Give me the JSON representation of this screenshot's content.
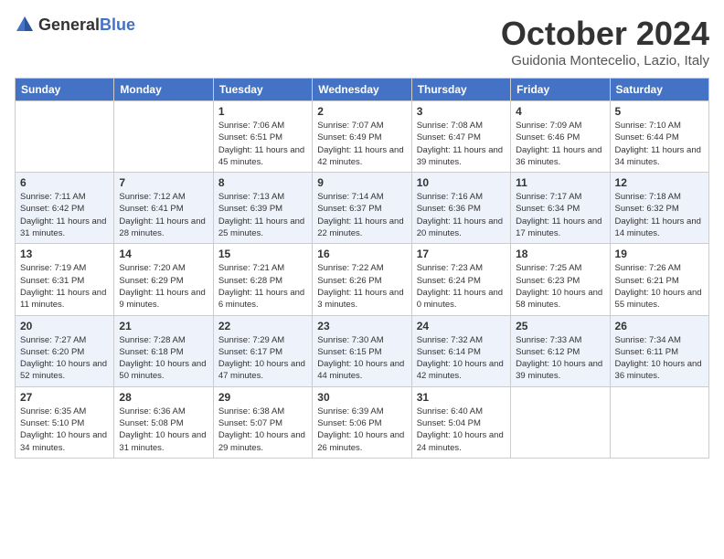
{
  "header": {
    "logo_general": "General",
    "logo_blue": "Blue",
    "month_title": "October 2024",
    "location": "Guidonia Montecelio, Lazio, Italy"
  },
  "days_of_week": [
    "Sunday",
    "Monday",
    "Tuesday",
    "Wednesday",
    "Thursday",
    "Friday",
    "Saturday"
  ],
  "weeks": [
    [
      {
        "day": "",
        "content": ""
      },
      {
        "day": "",
        "content": ""
      },
      {
        "day": "1",
        "content": "Sunrise: 7:06 AM\nSunset: 6:51 PM\nDaylight: 11 hours and 45 minutes."
      },
      {
        "day": "2",
        "content": "Sunrise: 7:07 AM\nSunset: 6:49 PM\nDaylight: 11 hours and 42 minutes."
      },
      {
        "day": "3",
        "content": "Sunrise: 7:08 AM\nSunset: 6:47 PM\nDaylight: 11 hours and 39 minutes."
      },
      {
        "day": "4",
        "content": "Sunrise: 7:09 AM\nSunset: 6:46 PM\nDaylight: 11 hours and 36 minutes."
      },
      {
        "day": "5",
        "content": "Sunrise: 7:10 AM\nSunset: 6:44 PM\nDaylight: 11 hours and 34 minutes."
      }
    ],
    [
      {
        "day": "6",
        "content": "Sunrise: 7:11 AM\nSunset: 6:42 PM\nDaylight: 11 hours and 31 minutes."
      },
      {
        "day": "7",
        "content": "Sunrise: 7:12 AM\nSunset: 6:41 PM\nDaylight: 11 hours and 28 minutes."
      },
      {
        "day": "8",
        "content": "Sunrise: 7:13 AM\nSunset: 6:39 PM\nDaylight: 11 hours and 25 minutes."
      },
      {
        "day": "9",
        "content": "Sunrise: 7:14 AM\nSunset: 6:37 PM\nDaylight: 11 hours and 22 minutes."
      },
      {
        "day": "10",
        "content": "Sunrise: 7:16 AM\nSunset: 6:36 PM\nDaylight: 11 hours and 20 minutes."
      },
      {
        "day": "11",
        "content": "Sunrise: 7:17 AM\nSunset: 6:34 PM\nDaylight: 11 hours and 17 minutes."
      },
      {
        "day": "12",
        "content": "Sunrise: 7:18 AM\nSunset: 6:32 PM\nDaylight: 11 hours and 14 minutes."
      }
    ],
    [
      {
        "day": "13",
        "content": "Sunrise: 7:19 AM\nSunset: 6:31 PM\nDaylight: 11 hours and 11 minutes."
      },
      {
        "day": "14",
        "content": "Sunrise: 7:20 AM\nSunset: 6:29 PM\nDaylight: 11 hours and 9 minutes."
      },
      {
        "day": "15",
        "content": "Sunrise: 7:21 AM\nSunset: 6:28 PM\nDaylight: 11 hours and 6 minutes."
      },
      {
        "day": "16",
        "content": "Sunrise: 7:22 AM\nSunset: 6:26 PM\nDaylight: 11 hours and 3 minutes."
      },
      {
        "day": "17",
        "content": "Sunrise: 7:23 AM\nSunset: 6:24 PM\nDaylight: 11 hours and 0 minutes."
      },
      {
        "day": "18",
        "content": "Sunrise: 7:25 AM\nSunset: 6:23 PM\nDaylight: 10 hours and 58 minutes."
      },
      {
        "day": "19",
        "content": "Sunrise: 7:26 AM\nSunset: 6:21 PM\nDaylight: 10 hours and 55 minutes."
      }
    ],
    [
      {
        "day": "20",
        "content": "Sunrise: 7:27 AM\nSunset: 6:20 PM\nDaylight: 10 hours and 52 minutes."
      },
      {
        "day": "21",
        "content": "Sunrise: 7:28 AM\nSunset: 6:18 PM\nDaylight: 10 hours and 50 minutes."
      },
      {
        "day": "22",
        "content": "Sunrise: 7:29 AM\nSunset: 6:17 PM\nDaylight: 10 hours and 47 minutes."
      },
      {
        "day": "23",
        "content": "Sunrise: 7:30 AM\nSunset: 6:15 PM\nDaylight: 10 hours and 44 minutes."
      },
      {
        "day": "24",
        "content": "Sunrise: 7:32 AM\nSunset: 6:14 PM\nDaylight: 10 hours and 42 minutes."
      },
      {
        "day": "25",
        "content": "Sunrise: 7:33 AM\nSunset: 6:12 PM\nDaylight: 10 hours and 39 minutes."
      },
      {
        "day": "26",
        "content": "Sunrise: 7:34 AM\nSunset: 6:11 PM\nDaylight: 10 hours and 36 minutes."
      }
    ],
    [
      {
        "day": "27",
        "content": "Sunrise: 6:35 AM\nSunset: 5:10 PM\nDaylight: 10 hours and 34 minutes."
      },
      {
        "day": "28",
        "content": "Sunrise: 6:36 AM\nSunset: 5:08 PM\nDaylight: 10 hours and 31 minutes."
      },
      {
        "day": "29",
        "content": "Sunrise: 6:38 AM\nSunset: 5:07 PM\nDaylight: 10 hours and 29 minutes."
      },
      {
        "day": "30",
        "content": "Sunrise: 6:39 AM\nSunset: 5:06 PM\nDaylight: 10 hours and 26 minutes."
      },
      {
        "day": "31",
        "content": "Sunrise: 6:40 AM\nSunset: 5:04 PM\nDaylight: 10 hours and 24 minutes."
      },
      {
        "day": "",
        "content": ""
      },
      {
        "day": "",
        "content": ""
      }
    ]
  ]
}
